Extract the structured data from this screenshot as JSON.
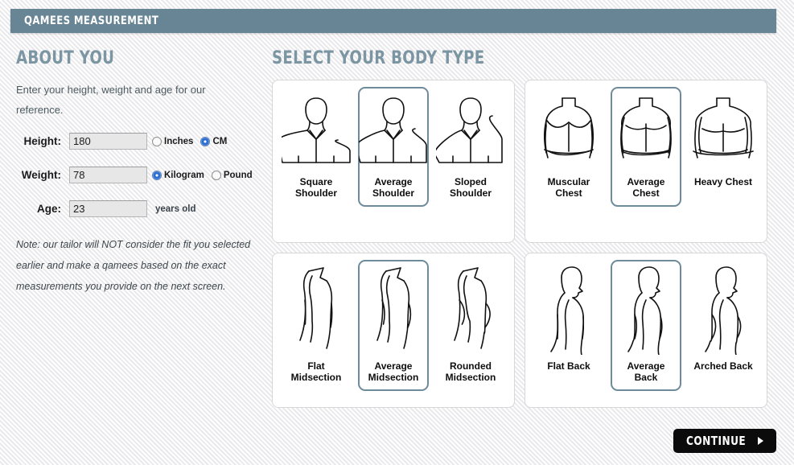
{
  "header": {
    "title": "QAMEES MEASUREMENT"
  },
  "about": {
    "title": "ABOUT YOU",
    "lead": "Enter your height, weight and age for our reference.",
    "note": "Note: our tailor will NOT consider the fit you selected earlier and make a qamees based on the exact measurements you provide on the next screen.",
    "fields": [
      {
        "label": "Height:",
        "value": "180",
        "placeholder": "",
        "units": [
          {
            "label": "Inches",
            "selected": false
          },
          {
            "label": "CM",
            "selected": true
          }
        ],
        "suffix": ""
      },
      {
        "label": "Weight:",
        "value": "78",
        "placeholder": "",
        "units": [
          {
            "label": "Kilogram",
            "selected": true
          },
          {
            "label": "Pound",
            "selected": false
          }
        ],
        "suffix": ""
      },
      {
        "label": "Age:",
        "value": "23",
        "placeholder": "",
        "units": [],
        "suffix": "years old"
      }
    ]
  },
  "body_type": {
    "title": "SELECT YOUR BODY TYPE",
    "groups": [
      {
        "name": "shoulder",
        "figure": "shoulder",
        "options": [
          {
            "label": "Square\nShoulder",
            "line1": "Square",
            "line2": "Shoulder",
            "selected": false,
            "variant": "square"
          },
          {
            "label": "Average\nShoulder",
            "line1": "Average",
            "line2": "Shoulder",
            "selected": true,
            "variant": "average"
          },
          {
            "label": "Sloped\nShoulder",
            "line1": "Sloped",
            "line2": "Shoulder",
            "selected": false,
            "variant": "sloped"
          }
        ]
      },
      {
        "name": "chest",
        "figure": "chest",
        "options": [
          {
            "label": "Muscular\nChest",
            "line1": "Muscular",
            "line2": "Chest",
            "selected": false,
            "variant": "muscular"
          },
          {
            "label": "Average\nChest",
            "line1": "Average",
            "line2": "Chest",
            "selected": true,
            "variant": "average"
          },
          {
            "label": "Heavy Chest",
            "line1": "Heavy Chest",
            "line2": "",
            "selected": false,
            "variant": "heavy"
          }
        ]
      },
      {
        "name": "midsection",
        "figure": "midsection",
        "options": [
          {
            "label": "Flat\nMidsection",
            "line1": "Flat",
            "line2": "Midsection",
            "selected": false,
            "variant": "flat"
          },
          {
            "label": "Average\nMidsection",
            "line1": "Average",
            "line2": "Midsection",
            "selected": true,
            "variant": "average"
          },
          {
            "label": "Rounded\nMidsection",
            "line1": "Rounded",
            "line2": "Midsection",
            "selected": false,
            "variant": "rounded"
          }
        ]
      },
      {
        "name": "back",
        "figure": "back",
        "options": [
          {
            "label": "Flat Back",
            "line1": "Flat Back",
            "line2": "",
            "selected": false,
            "variant": "flat"
          },
          {
            "label": "Average\nBack",
            "line1": "Average",
            "line2": "Back",
            "selected": true,
            "variant": "average"
          },
          {
            "label": "Arched Back",
            "line1": "Arched Back",
            "line2": "",
            "selected": false,
            "variant": "arched"
          }
        ]
      }
    ]
  },
  "footer": {
    "continue_label": "CONTINUE"
  },
  "colors": {
    "header_bar": "#678595",
    "heading": "#7b95a3",
    "selected_border": "#6d8b9b",
    "panel_border": "#d7d7d7",
    "button": "#0b0b0b",
    "radio_selected": "#2b6fd4"
  }
}
